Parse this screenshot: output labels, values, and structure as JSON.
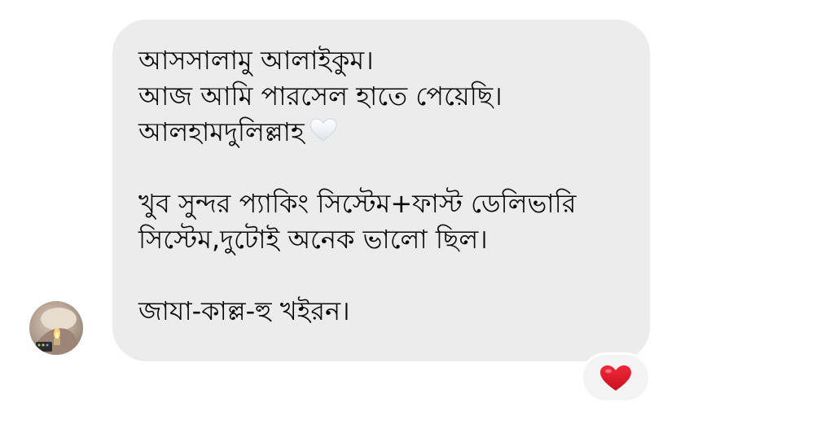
{
  "message": {
    "lines": [
      "আসসালামু আলাইকুম।",
      "আজ আমি পারসেল হাতে পেয়েছি।",
      "আলহামদুলিল্লাহ",
      "",
      "খুব সুন্দর প্যাকিং সিস্টেম+ফাস্ট ডেলিভারি",
      "সিস্টেম,দুটোই অনেক ভালো ছিল।",
      "",
      "জাযা-কাল্ল-হু খইরন।"
    ],
    "inline_emoji": "white-heart-icon",
    "bubble_color": "#ececed"
  },
  "sender": {
    "avatar": "profile-photo"
  },
  "reaction": {
    "icon": "red-heart-icon",
    "color": "#e0192b"
  }
}
